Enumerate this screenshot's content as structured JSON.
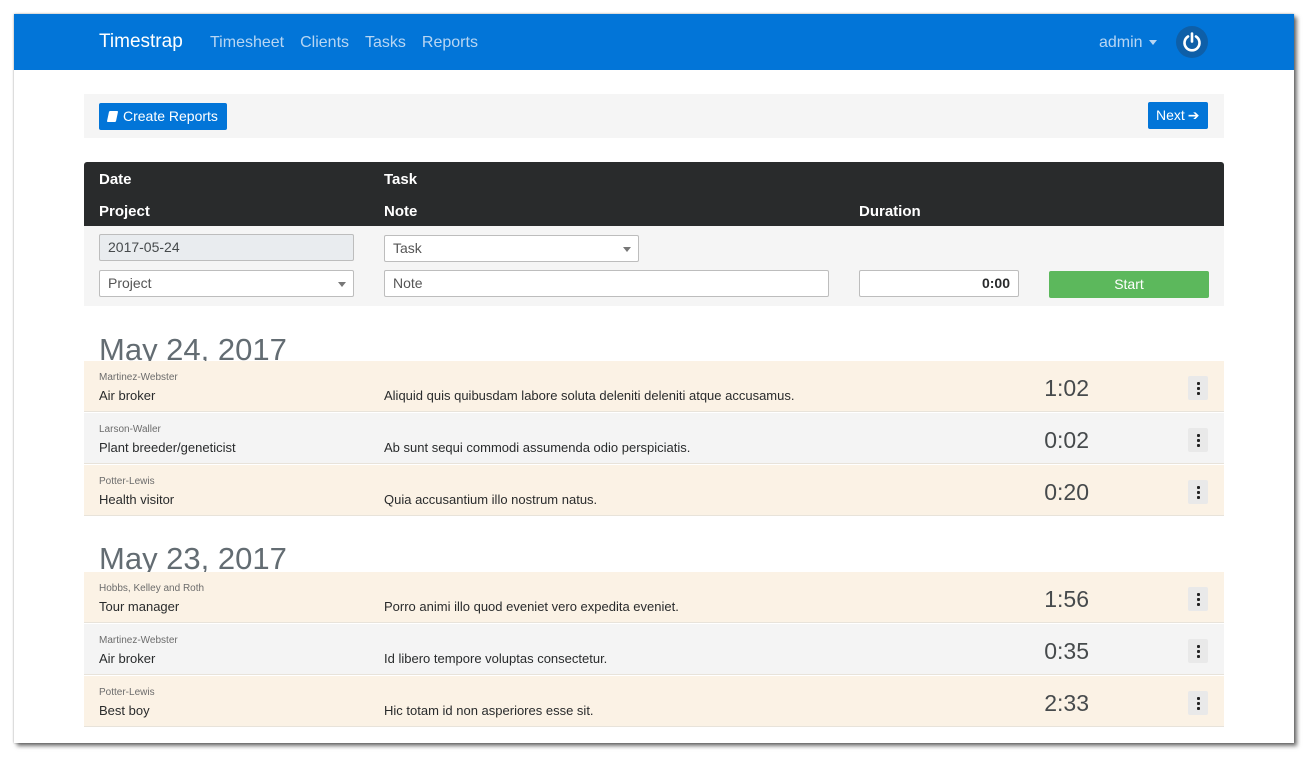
{
  "nav": {
    "brand": "Timestrap",
    "links": [
      "Timesheet",
      "Clients",
      "Tasks",
      "Reports"
    ],
    "user": "admin"
  },
  "toolbar": {
    "create_label": "Create Reports",
    "next_label": "Next"
  },
  "table_header": {
    "date": "Date",
    "task": "Task",
    "project": "Project",
    "note": "Note",
    "duration": "Duration"
  },
  "form": {
    "date_value": "2017-05-24",
    "task_placeholder": "Task",
    "project_placeholder": "Project",
    "note_placeholder": "Note",
    "duration_value": "0:00",
    "start_label": "Start"
  },
  "days": [
    {
      "heading": "May 24, 2017",
      "entries": [
        {
          "client": "Martinez-Webster",
          "task": "Air broker",
          "note": "Aliquid quis quibusdam labore soluta deleniti deleniti atque accusamus.",
          "duration": "1:02"
        },
        {
          "client": "Larson-Waller",
          "task": "Plant breeder/geneticist",
          "note": "Ab sunt sequi commodi assumenda odio perspiciatis.",
          "duration": "0:02"
        },
        {
          "client": "Potter-Lewis",
          "task": "Health visitor",
          "note": "Quia accusantium illo nostrum natus.",
          "duration": "0:20"
        }
      ]
    },
    {
      "heading": "May 23, 2017",
      "entries": [
        {
          "client": "Hobbs, Kelley and Roth",
          "task": "Tour manager",
          "note": "Porro animi illo quod eveniet vero expedita eveniet.",
          "duration": "1:56"
        },
        {
          "client": "Martinez-Webster",
          "task": "Air broker",
          "note": "Id libero tempore voluptas consectetur.",
          "duration": "0:35"
        },
        {
          "client": "Potter-Lewis",
          "task": "Best boy",
          "note": "Hic totam id non asperiores esse sit.",
          "duration": "2:33"
        }
      ]
    }
  ],
  "colors": {
    "primary": "#0275d8",
    "success": "#5cb85c",
    "header_dark": "#292b2c",
    "row_odd": "#fbf2e5",
    "row_even": "#f4f4f4"
  }
}
